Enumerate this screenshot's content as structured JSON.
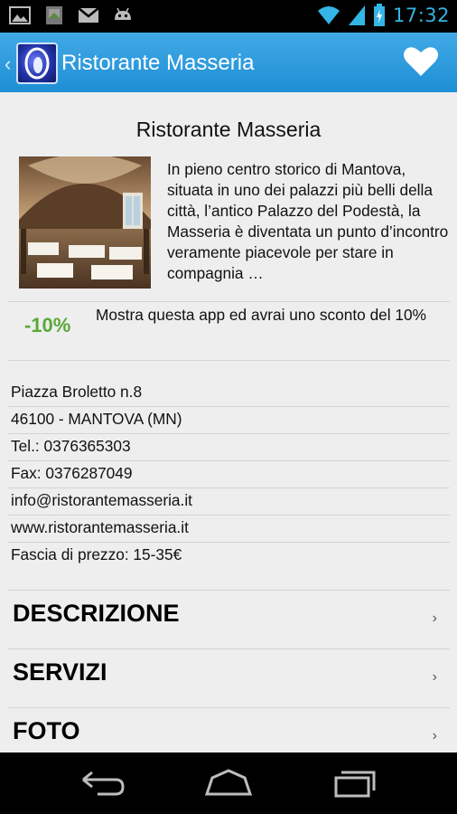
{
  "status_bar": {
    "time": "17:32",
    "notification_icons": [
      "image-icon",
      "sd-card-icon",
      "gmail-icon",
      "android-icon"
    ],
    "system_icons": [
      "wifi-icon",
      "signal-icon",
      "battery-icon"
    ],
    "accent_color": "#33b5e5"
  },
  "action_bar": {
    "title": "Ristorante Masseria",
    "icons": [
      "back-chevron-icon",
      "app-logo-icon",
      "heart-icon"
    ],
    "background_color": "#2a9ad9"
  },
  "restaurant": {
    "name": "Ristorante Masseria",
    "description": "In pieno centro storico di Mantova, situata in uno dei palazzi più belli della città, l’antico Palazzo del Podestà, la Masseria è diventata un punto d’incontro veramente piacevole per stare in compagnia …",
    "discount_badge": "-10%",
    "discount_text": "Mostra questa app ed avrai uno sconto del 10%",
    "discount_color": "#5aa83a"
  },
  "info": {
    "address": "Piazza Broletto n.8",
    "city": "46100 - MANTOVA (MN)",
    "phone": "Tel.: 0376365303",
    "fax": "Fax: 0376287049",
    "email": "info@ristorantemasseria.it",
    "website": "www.ristorantemasseria.it",
    "price_range": "Fascia di prezzo: 15-35€"
  },
  "sections": [
    {
      "label": "DESCRIZIONE",
      "chevron": "›"
    },
    {
      "label": "SERVIZI",
      "chevron": "›"
    },
    {
      "label": "FOTO",
      "chevron": "›"
    }
  ],
  "nav_bar": {
    "icons": [
      "back-nav-icon",
      "home-nav-icon",
      "recents-nav-icon"
    ]
  }
}
